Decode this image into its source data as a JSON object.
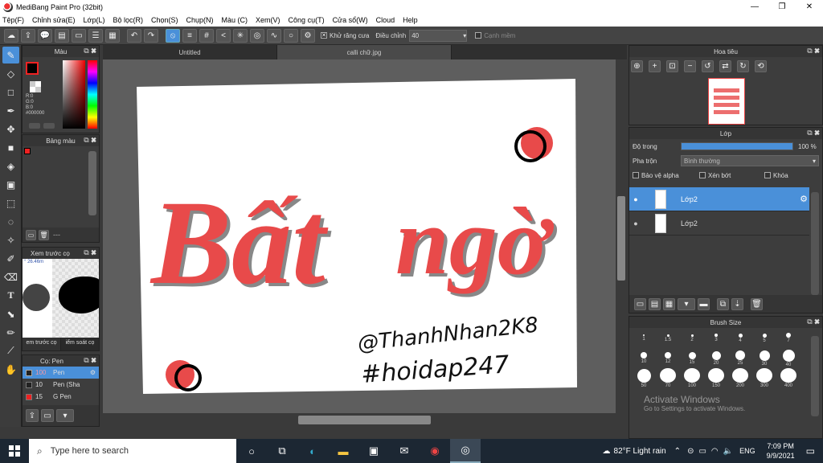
{
  "window": {
    "title": "MediBang Paint Pro (32bit)",
    "minimize": "—",
    "maximize": "❐",
    "close": "✕"
  },
  "menu": [
    "Tệp(F)",
    "Chỉnh sửa(E)",
    "Lớp(L)",
    "Bộ lọc(R)",
    "Chọn(S)",
    "Chụp(N)",
    "Màu (C)",
    "Xem(V)",
    "Công cụ(T)",
    "Cửa sổ(W)",
    "Cloud",
    "Help"
  ],
  "toolbar": {
    "antialias_label": "Khử răng cưa",
    "correction_label": "Điều chỉnh",
    "correction_value": "40",
    "soft_edge_label": "Cạnh mềm"
  },
  "color_panel": {
    "title": "Màu",
    "r": "R:0",
    "g": "G:0",
    "b": "B:0",
    "hex": "#000000"
  },
  "palette_panel": {
    "title": "Bảng màu",
    "footer": "---"
  },
  "preview_panel": {
    "title": "Xem trước cọ",
    "zoom": "° 26.46m",
    "tab1": "em trước cọ",
    "tab2": "iểm soát cọ"
  },
  "brush_panel": {
    "title": "Cọ: Pen",
    "items": [
      {
        "size": "100",
        "name": "Pen"
      },
      {
        "size": "10",
        "name": "Pen (Sha"
      },
      {
        "size": "15",
        "name": "G Pen"
      }
    ]
  },
  "doc_tabs": [
    "Untitled",
    "calli chữ.jpg"
  ],
  "navigator": {
    "title": "Hoa tiêu"
  },
  "layer_panel": {
    "title": "Lớp",
    "opacity_label": "Độ trong",
    "opacity_value": "100 %",
    "opacity_pct": 100,
    "blend_label": "Pha trộn",
    "blend_value": "Bình thường",
    "protect_alpha": "Bảo vệ alpha",
    "clipping": "Xén bớt",
    "lock": "Khóa",
    "layers": [
      "Lớp2",
      "Lớp2"
    ]
  },
  "brush_size": {
    "title": "Brush Size",
    "sizes": [
      "1",
      "1.5",
      "2",
      "3",
      "4",
      "5",
      "7",
      "10",
      "12",
      "15",
      "20",
      "25",
      "30",
      "40",
      "50",
      "70",
      "100",
      "150",
      "200",
      "300",
      "400"
    ]
  },
  "artwork": {
    "word1": "Bất",
    "word2": "ngờ",
    "handle": "@ThanhNhan2K8",
    "tag": "#hoidap247"
  },
  "watermark": {
    "line1": "Activate Windows",
    "line2": "Go to Settings to activate Windows."
  },
  "taskbar": {
    "search_placeholder": "Type here to search",
    "weather": "82°F  Light rain",
    "lang": "ENG",
    "time": "7:09 PM",
    "date": "9/9/2021"
  },
  "colors": {
    "accent": "#4a90d9",
    "art_red": "#e84a4a",
    "panel_bg": "#3d3d3d"
  }
}
